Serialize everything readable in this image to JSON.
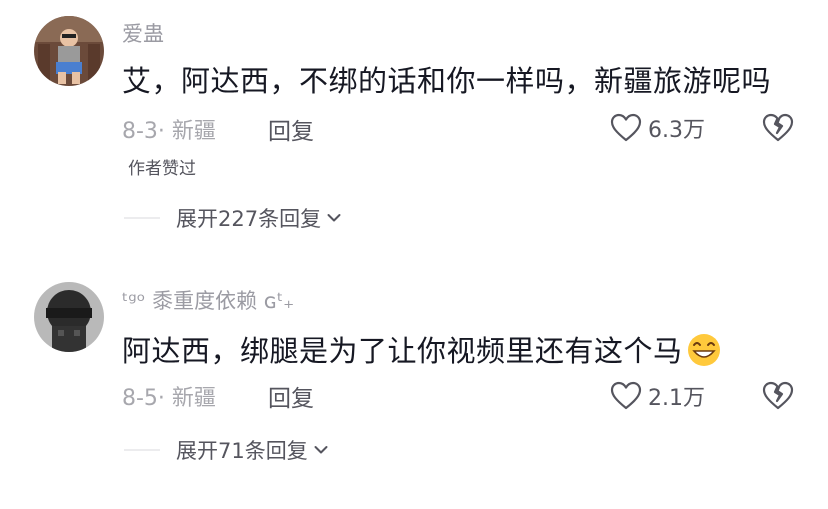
{
  "comments": [
    {
      "username": "爱蛊",
      "text": "艾，阿达西，不绑的话和你一样吗，新疆旅游呢吗",
      "meta": "8-3· 新疆",
      "reply": "回复",
      "likes": "6.3万",
      "author_liked": "作者赞过",
      "expand": "展开227条回复"
    },
    {
      "username": "ᵗᵍᵒ 黍重度依赖 ɢᵗ₊",
      "text": "阿达西，绑腿是为了让你视频里还有这个马",
      "meta": "8-5· 新疆",
      "reply": "回复",
      "likes": "2.1万",
      "expand": "展开71条回复"
    }
  ],
  "icons": {
    "like": "heart-outline-icon",
    "dislike": "broken-heart-icon",
    "expand": "chevron-down-icon",
    "emoji": "grinning-face-emoji"
  }
}
